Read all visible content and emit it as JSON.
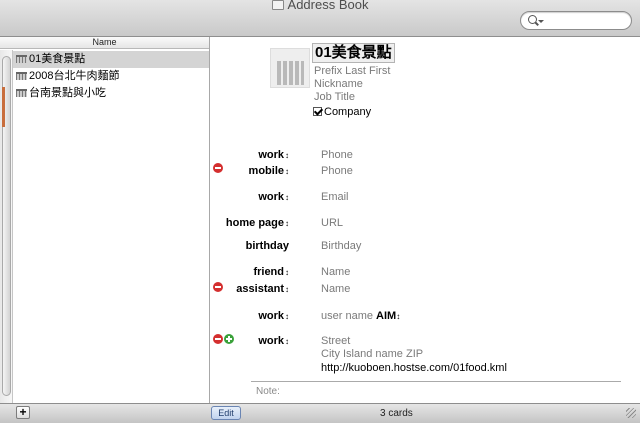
{
  "window": {
    "title": "Address Book"
  },
  "groups": {
    "column_header": "Name",
    "items": [
      {
        "label": "01美食景點",
        "selected": true
      },
      {
        "label": "2008台北牛肉麵節",
        "selected": false
      },
      {
        "label": "台南景點與小吃",
        "selected": false
      }
    ]
  },
  "card": {
    "name": "01美食景點",
    "prefix_line": "Prefix Last First",
    "nickname": "Nickname",
    "job_title": "Job Title",
    "company_label": "Company",
    "company_checked": true,
    "phones": [
      {
        "label": "work",
        "value": "Phone"
      },
      {
        "label": "mobile",
        "value": "Phone"
      }
    ],
    "email": {
      "label": "work",
      "value": "Email"
    },
    "url": {
      "label": "home page",
      "value": "URL"
    },
    "birthday": {
      "label": "birthday",
      "value": "Birthday"
    },
    "related": [
      {
        "label": "friend",
        "value": "Name"
      },
      {
        "label": "assistant",
        "value": "Name"
      }
    ],
    "im": {
      "label": "work",
      "value": "user name",
      "service": "AIM"
    },
    "address": {
      "label": "work",
      "street": "Street",
      "city_line": "City Island name ZIP",
      "extra_line": "http://kuoboen.hostse.com/01food.kml"
    },
    "note_label": "Note:"
  },
  "toolbar": {
    "add_label": "+",
    "edit_label": "Edit",
    "count_label": "3 cards"
  },
  "colors": {
    "remove": "#d42f2f",
    "add": "#3aa13a",
    "selection": "#d4d4d4"
  }
}
